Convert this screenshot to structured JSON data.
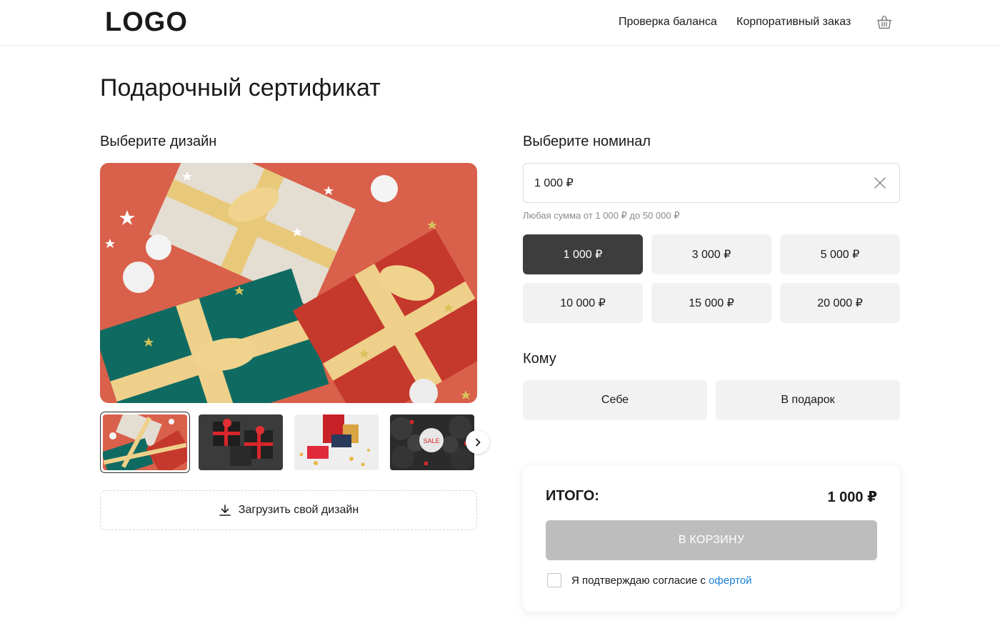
{
  "header": {
    "logo": "LOGO",
    "nav_balance": "Проверка баланса",
    "nav_corporate": "Корпоративный заказ",
    "cart_icon": "basket-icon"
  },
  "page": {
    "title": "Подарочный сертификат"
  },
  "design": {
    "section_title": "Выберите дизайн",
    "thumbnails": [
      "gift-boxes-red",
      "black-boxes",
      "person-unwrapping",
      "sale-balloons"
    ],
    "thumb_sale_text": "SALE",
    "selected_thumbnail": 0,
    "upload_label": "Загрузить свой дизайн"
  },
  "nominal": {
    "section_title": "Выберите номинал",
    "input_value": "1 000 ₽",
    "hint": "Любая сумма от 1 000 ₽ до 50 000 ₽",
    "options": [
      "1 000 ₽",
      "3 000 ₽",
      "5 000 ₽",
      "10 000 ₽",
      "15 000 ₽",
      "20 000 ₽"
    ],
    "selected_index": 0
  },
  "recipient": {
    "section_title": "Кому",
    "self_label": "Себе",
    "gift_label": "В подарок"
  },
  "summary": {
    "total_label": "ИТОГО:",
    "total_value": "1 000 ₽",
    "cart_button": "В КОРЗИНУ",
    "agree_text": "Я подтверждаю согласие с ",
    "agree_link": "офертой",
    "agree_checked": false
  },
  "colors": {
    "selected_denom_bg": "#3d3d3d",
    "tile_bg": "#f2f2f3",
    "disabled_button": "#bdbdbd",
    "link": "#1a7fd6"
  }
}
